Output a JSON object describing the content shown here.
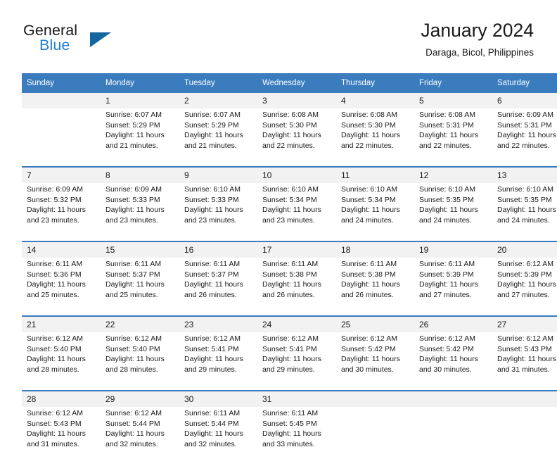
{
  "brand": {
    "word_general": "General",
    "word_blue": "Blue",
    "accent_color": "#1f7fd0",
    "triangle_color": "#14669e"
  },
  "header": {
    "title": "January 2024",
    "subtitle": "Daraga, Bicol, Philippines"
  },
  "calendar": {
    "header_bg": "#3a7cbe",
    "daynum_bg": "#f2f2f2",
    "weekday_headers": [
      "Sunday",
      "Monday",
      "Tuesday",
      "Wednesday",
      "Thursday",
      "Friday",
      "Saturday"
    ],
    "weeks": [
      [
        {
          "day": "",
          "sunrise": "",
          "sunset": "",
          "daylight1": "",
          "daylight2": ""
        },
        {
          "day": "1",
          "sunrise": "Sunrise: 6:07 AM",
          "sunset": "Sunset: 5:29 PM",
          "daylight1": "Daylight: 11 hours",
          "daylight2": "and 21 minutes."
        },
        {
          "day": "2",
          "sunrise": "Sunrise: 6:07 AM",
          "sunset": "Sunset: 5:29 PM",
          "daylight1": "Daylight: 11 hours",
          "daylight2": "and 21 minutes."
        },
        {
          "day": "3",
          "sunrise": "Sunrise: 6:08 AM",
          "sunset": "Sunset: 5:30 PM",
          "daylight1": "Daylight: 11 hours",
          "daylight2": "and 22 minutes."
        },
        {
          "day": "4",
          "sunrise": "Sunrise: 6:08 AM",
          "sunset": "Sunset: 5:30 PM",
          "daylight1": "Daylight: 11 hours",
          "daylight2": "and 22 minutes."
        },
        {
          "day": "5",
          "sunrise": "Sunrise: 6:08 AM",
          "sunset": "Sunset: 5:31 PM",
          "daylight1": "Daylight: 11 hours",
          "daylight2": "and 22 minutes."
        },
        {
          "day": "6",
          "sunrise": "Sunrise: 6:09 AM",
          "sunset": "Sunset: 5:31 PM",
          "daylight1": "Daylight: 11 hours",
          "daylight2": "and 22 minutes."
        }
      ],
      [
        {
          "day": "7",
          "sunrise": "Sunrise: 6:09 AM",
          "sunset": "Sunset: 5:32 PM",
          "daylight1": "Daylight: 11 hours",
          "daylight2": "and 23 minutes."
        },
        {
          "day": "8",
          "sunrise": "Sunrise: 6:09 AM",
          "sunset": "Sunset: 5:33 PM",
          "daylight1": "Daylight: 11 hours",
          "daylight2": "and 23 minutes."
        },
        {
          "day": "9",
          "sunrise": "Sunrise: 6:10 AM",
          "sunset": "Sunset: 5:33 PM",
          "daylight1": "Daylight: 11 hours",
          "daylight2": "and 23 minutes."
        },
        {
          "day": "10",
          "sunrise": "Sunrise: 6:10 AM",
          "sunset": "Sunset: 5:34 PM",
          "daylight1": "Daylight: 11 hours",
          "daylight2": "and 23 minutes."
        },
        {
          "day": "11",
          "sunrise": "Sunrise: 6:10 AM",
          "sunset": "Sunset: 5:34 PM",
          "daylight1": "Daylight: 11 hours",
          "daylight2": "and 24 minutes."
        },
        {
          "day": "12",
          "sunrise": "Sunrise: 6:10 AM",
          "sunset": "Sunset: 5:35 PM",
          "daylight1": "Daylight: 11 hours",
          "daylight2": "and 24 minutes."
        },
        {
          "day": "13",
          "sunrise": "Sunrise: 6:10 AM",
          "sunset": "Sunset: 5:35 PM",
          "daylight1": "Daylight: 11 hours",
          "daylight2": "and 24 minutes."
        }
      ],
      [
        {
          "day": "14",
          "sunrise": "Sunrise: 6:11 AM",
          "sunset": "Sunset: 5:36 PM",
          "daylight1": "Daylight: 11 hours",
          "daylight2": "and 25 minutes."
        },
        {
          "day": "15",
          "sunrise": "Sunrise: 6:11 AM",
          "sunset": "Sunset: 5:37 PM",
          "daylight1": "Daylight: 11 hours",
          "daylight2": "and 25 minutes."
        },
        {
          "day": "16",
          "sunrise": "Sunrise: 6:11 AM",
          "sunset": "Sunset: 5:37 PM",
          "daylight1": "Daylight: 11 hours",
          "daylight2": "and 26 minutes."
        },
        {
          "day": "17",
          "sunrise": "Sunrise: 6:11 AM",
          "sunset": "Sunset: 5:38 PM",
          "daylight1": "Daylight: 11 hours",
          "daylight2": "and 26 minutes."
        },
        {
          "day": "18",
          "sunrise": "Sunrise: 6:11 AM",
          "sunset": "Sunset: 5:38 PM",
          "daylight1": "Daylight: 11 hours",
          "daylight2": "and 26 minutes."
        },
        {
          "day": "19",
          "sunrise": "Sunrise: 6:11 AM",
          "sunset": "Sunset: 5:39 PM",
          "daylight1": "Daylight: 11 hours",
          "daylight2": "and 27 minutes."
        },
        {
          "day": "20",
          "sunrise": "Sunrise: 6:12 AM",
          "sunset": "Sunset: 5:39 PM",
          "daylight1": "Daylight: 11 hours",
          "daylight2": "and 27 minutes."
        }
      ],
      [
        {
          "day": "21",
          "sunrise": "Sunrise: 6:12 AM",
          "sunset": "Sunset: 5:40 PM",
          "daylight1": "Daylight: 11 hours",
          "daylight2": "and 28 minutes."
        },
        {
          "day": "22",
          "sunrise": "Sunrise: 6:12 AM",
          "sunset": "Sunset: 5:40 PM",
          "daylight1": "Daylight: 11 hours",
          "daylight2": "and 28 minutes."
        },
        {
          "day": "23",
          "sunrise": "Sunrise: 6:12 AM",
          "sunset": "Sunset: 5:41 PM",
          "daylight1": "Daylight: 11 hours",
          "daylight2": "and 29 minutes."
        },
        {
          "day": "24",
          "sunrise": "Sunrise: 6:12 AM",
          "sunset": "Sunset: 5:41 PM",
          "daylight1": "Daylight: 11 hours",
          "daylight2": "and 29 minutes."
        },
        {
          "day": "25",
          "sunrise": "Sunrise: 6:12 AM",
          "sunset": "Sunset: 5:42 PM",
          "daylight1": "Daylight: 11 hours",
          "daylight2": "and 30 minutes."
        },
        {
          "day": "26",
          "sunrise": "Sunrise: 6:12 AM",
          "sunset": "Sunset: 5:42 PM",
          "daylight1": "Daylight: 11 hours",
          "daylight2": "and 30 minutes."
        },
        {
          "day": "27",
          "sunrise": "Sunrise: 6:12 AM",
          "sunset": "Sunset: 5:43 PM",
          "daylight1": "Daylight: 11 hours",
          "daylight2": "and 31 minutes."
        }
      ],
      [
        {
          "day": "28",
          "sunrise": "Sunrise: 6:12 AM",
          "sunset": "Sunset: 5:43 PM",
          "daylight1": "Daylight: 11 hours",
          "daylight2": "and 31 minutes."
        },
        {
          "day": "29",
          "sunrise": "Sunrise: 6:12 AM",
          "sunset": "Sunset: 5:44 PM",
          "daylight1": "Daylight: 11 hours",
          "daylight2": "and 32 minutes."
        },
        {
          "day": "30",
          "sunrise": "Sunrise: 6:11 AM",
          "sunset": "Sunset: 5:44 PM",
          "daylight1": "Daylight: 11 hours",
          "daylight2": "and 32 minutes."
        },
        {
          "day": "31",
          "sunrise": "Sunrise: 6:11 AM",
          "sunset": "Sunset: 5:45 PM",
          "daylight1": "Daylight: 11 hours",
          "daylight2": "and 33 minutes."
        },
        {
          "day": "",
          "sunrise": "",
          "sunset": "",
          "daylight1": "",
          "daylight2": ""
        },
        {
          "day": "",
          "sunrise": "",
          "sunset": "",
          "daylight1": "",
          "daylight2": ""
        },
        {
          "day": "",
          "sunrise": "",
          "sunset": "",
          "daylight1": "",
          "daylight2": ""
        }
      ]
    ]
  }
}
